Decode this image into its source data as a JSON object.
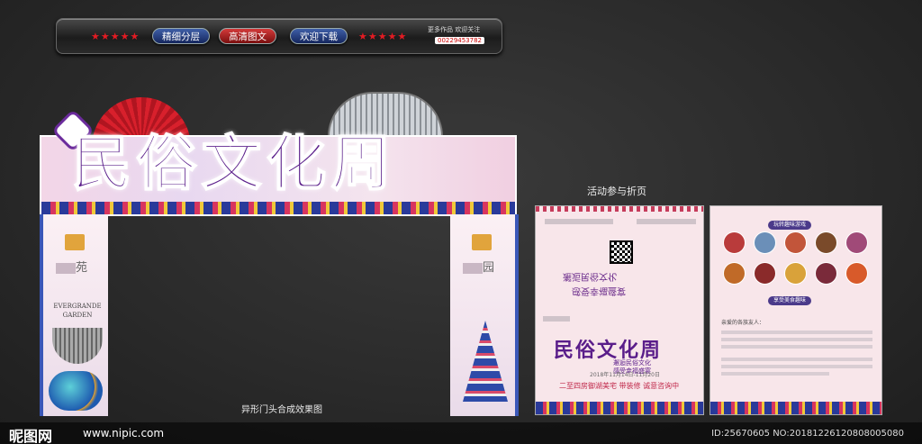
{
  "banner": {
    "stars_left": "★★★★★",
    "btn_layers": "精细分层",
    "btn_hd": "高清图文",
    "btn_download": "欢迎下载",
    "stars_right": "★★★★★",
    "more_works": "更多作品  欢迎关注",
    "author_number": "00229453782"
  },
  "arch": {
    "title": "民俗文化周",
    "pillar_left_sign": "苑",
    "pillar_right_sign": "园",
    "brand_name": "EVERGRANDE",
    "brand_sub": "GARDEN",
    "caption": "异形门头合成效果图"
  },
  "fold": {
    "caption": "活动参与折页",
    "mini_title": "民俗文化周",
    "mini_sub_line1": "邂逅民俗文化",
    "mini_sub_line2": "感受幸福盛宴",
    "mini_date": "2018年11月14日-11月20日",
    "mini_slogan": "二至四房御湖美宅  带装修  诚意咨询中",
    "badge_top": "玩转趣味游戏",
    "badge_mid": "享受美食趣味",
    "greeting": "亲爱的各族友人："
  },
  "footer": {
    "logo": "昵图网",
    "site": "www.nipic.com",
    "id_text": "ID:25670605 NO:20181226120808005080"
  },
  "colors": {
    "title_purple": "#5a1d8a",
    "accent_red": "#d8202c",
    "pattern_blue": "#2a3a9a"
  }
}
